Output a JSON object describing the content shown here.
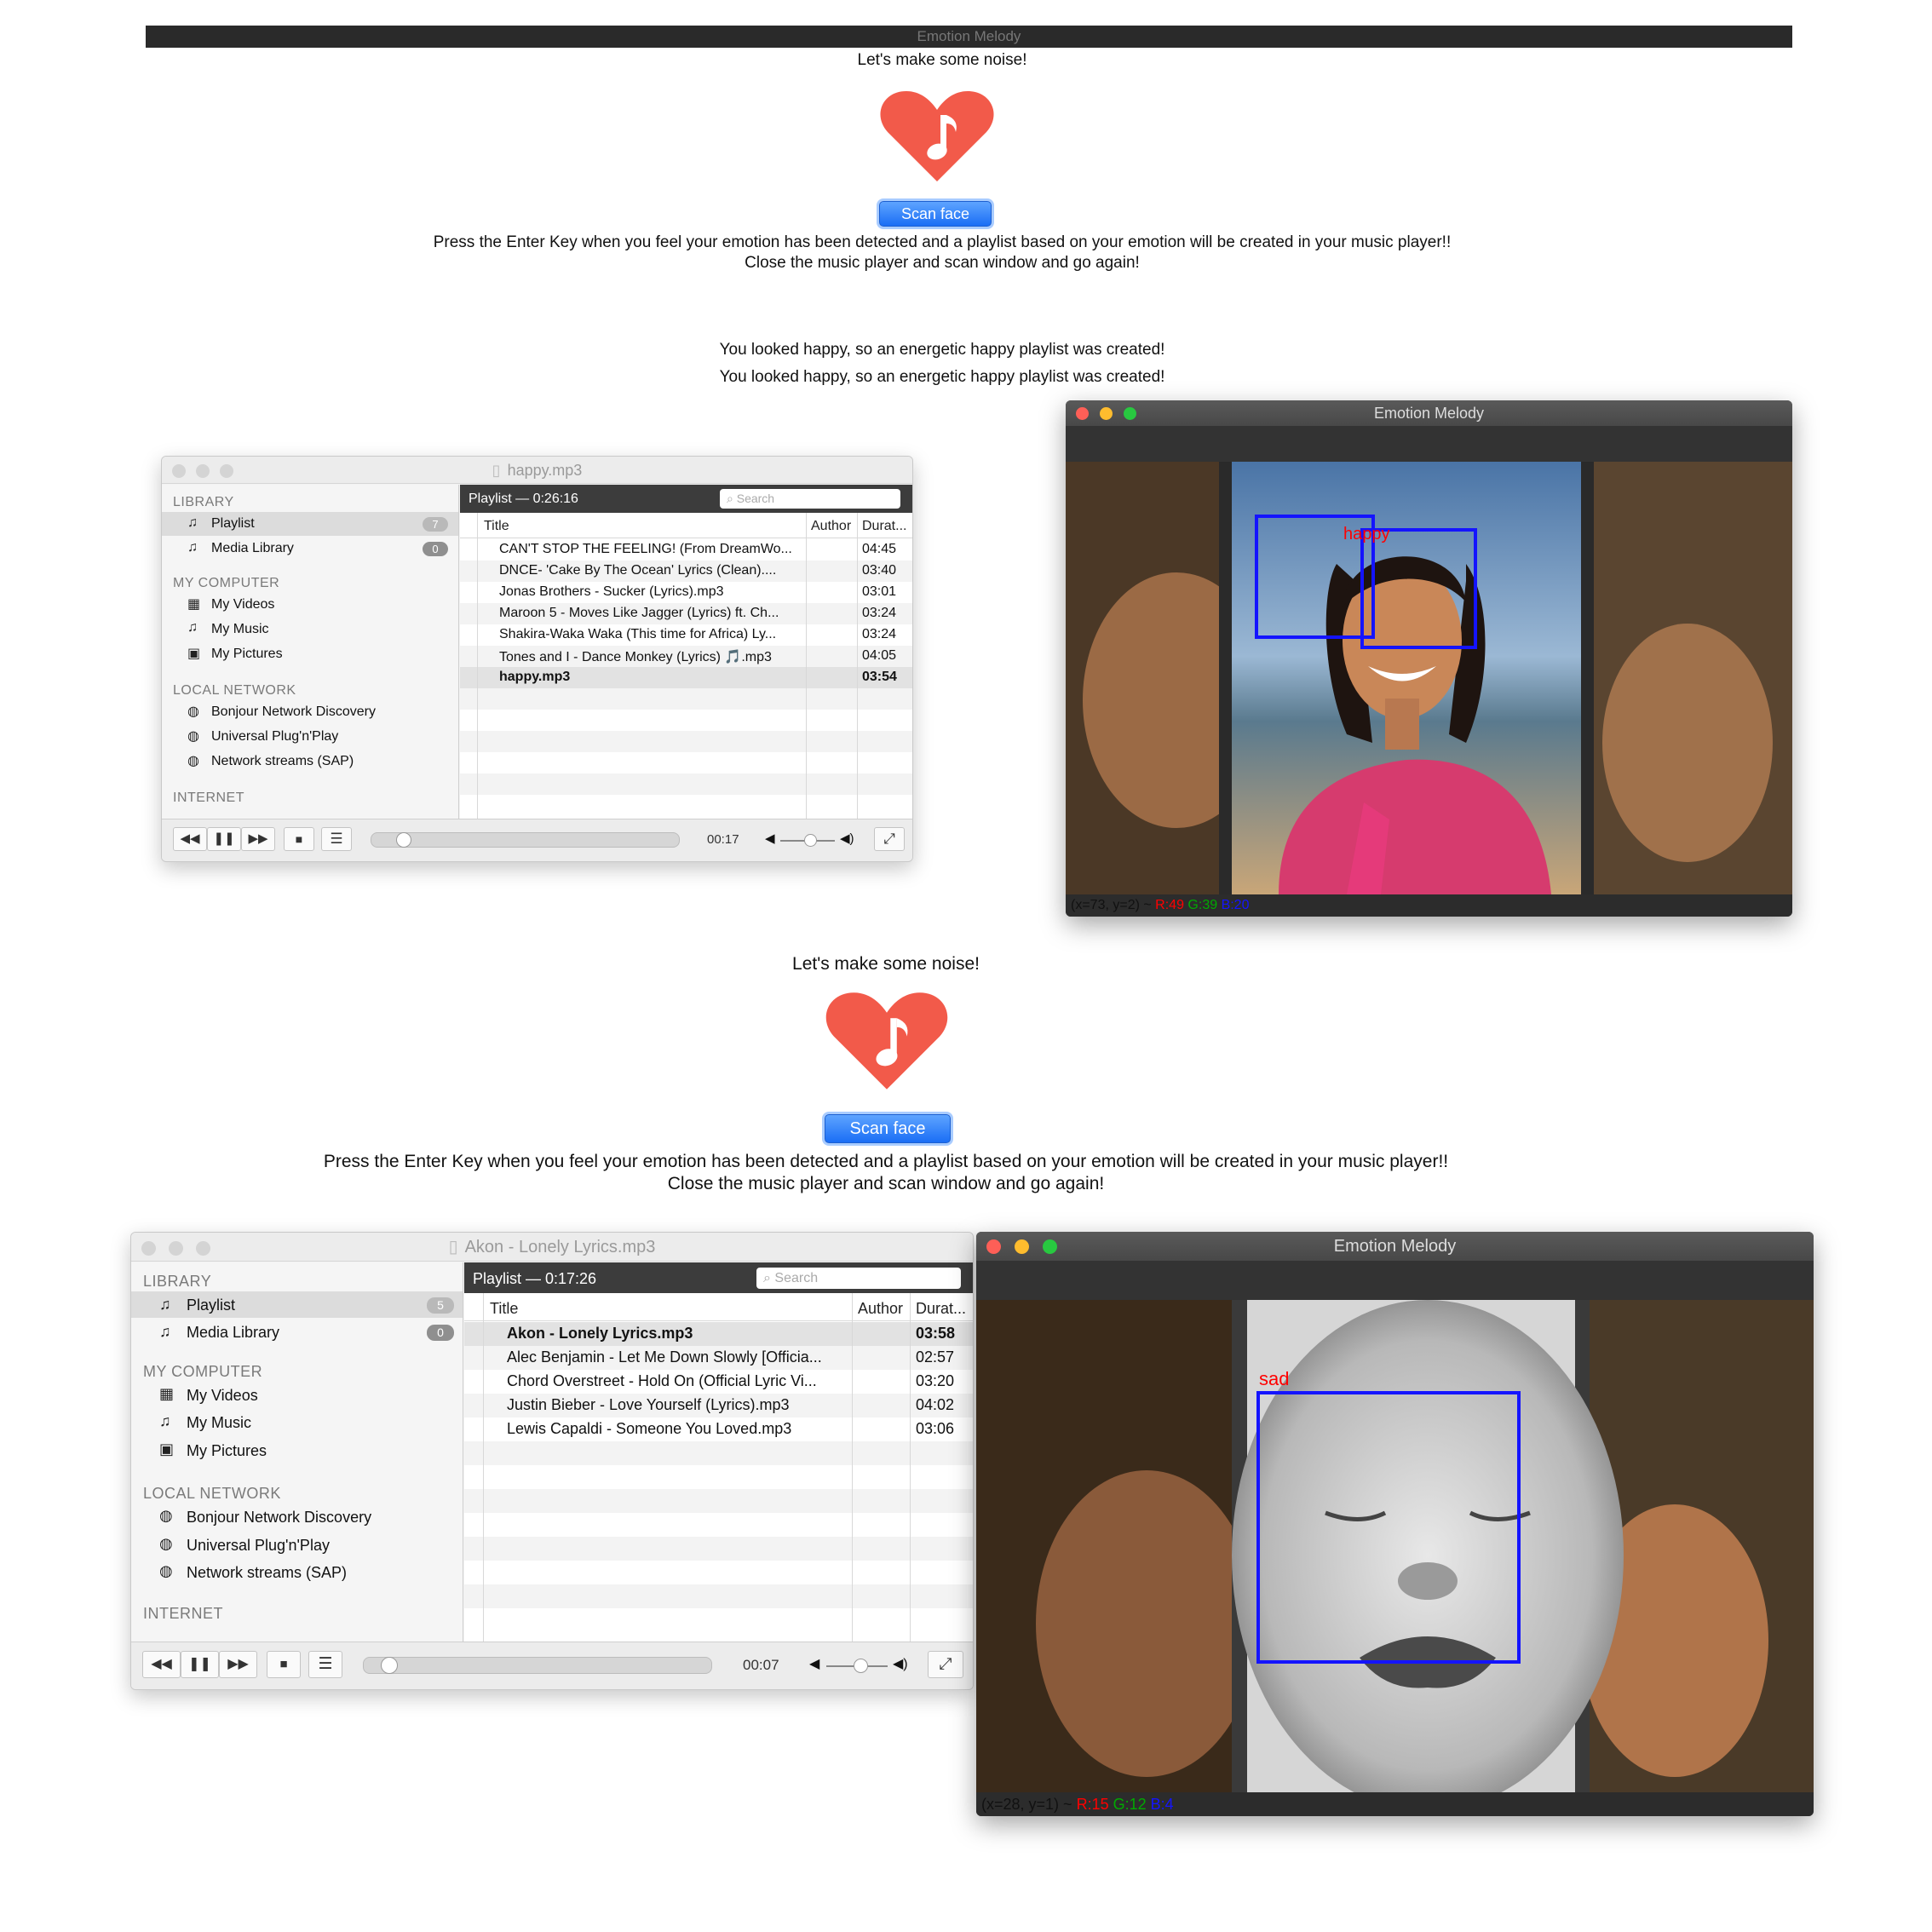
{
  "app_title": "Emotion Melody",
  "intro": {
    "tagline": "Let's make some noise!",
    "scan_button": "Scan face",
    "instruction_line1": "Press the Enter Key when you feel your emotion has been detected and a playlist based on your emotion will be created in your music player!!",
    "instruction_line2": "Close the music player and scan window and go again!"
  },
  "results": {
    "line1": "You looked happy, so an energetic happy playlist was created!",
    "line2": "You looked happy, so an energetic happy playlist was created!"
  },
  "player1": {
    "window_title": "happy.mp3",
    "playlist_header": "Playlist — 0:26:16",
    "search_placeholder": "Search",
    "sidebar": {
      "library_heading": "LIBRARY",
      "playlist_label": "Playlist",
      "playlist_count": "7",
      "media_library_label": "Media Library",
      "media_library_count": "0",
      "computer_heading": "MY COMPUTER",
      "my_videos": "My Videos",
      "my_music": "My Music",
      "my_pictures": "My Pictures",
      "network_heading": "LOCAL NETWORK",
      "bonjour": "Bonjour Network Discovery",
      "upnp": "Universal Plug'n'Play",
      "sap": "Network streams (SAP)",
      "internet_heading": "INTERNET"
    },
    "columns": {
      "title": "Title",
      "author": "Author",
      "duration": "Durat..."
    },
    "tracks": [
      {
        "title": "CAN'T STOP THE FEELING! (From DreamWo...",
        "duration": "04:45"
      },
      {
        "title": "DNCE- 'Cake By The Ocean' Lyrics (Clean)....",
        "duration": "03:40"
      },
      {
        "title": "Jonas Brothers - Sucker (Lyrics).mp3",
        "duration": "03:01"
      },
      {
        "title": "Maroon 5 - Moves Like Jagger (Lyrics) ft. Ch...",
        "duration": "03:24"
      },
      {
        "title": "Shakira-Waka Waka (This time for Africa) Ly...",
        "duration": "03:24"
      },
      {
        "title": "Tones and I - Dance Monkey (Lyrics) 🎵.mp3",
        "duration": "04:05"
      },
      {
        "title": "happy.mp3",
        "duration": "03:54"
      }
    ],
    "elapsed": "00:17",
    "progress": 0.06,
    "volume": 0.55
  },
  "camera1": {
    "title": "Emotion Melody",
    "emotion_label": "happy",
    "status_coords": "(x=73, y=2) ~",
    "status_r": "R:49",
    "status_g": "G:39",
    "status_b": "B:20"
  },
  "intro2": {
    "tagline": "Let's make some noise!",
    "scan_button": "Scan face",
    "instruction_line1": "Press the Enter Key when you feel your emotion has been detected and a playlist based on your emotion will be created in your music player!!",
    "instruction_line2": "Close the music player and scan window and go again!"
  },
  "player2": {
    "window_title": "Akon - Lonely Lyrics.mp3",
    "playlist_header": "Playlist — 0:17:26",
    "search_placeholder": "Search",
    "sidebar": {
      "library_heading": "LIBRARY",
      "playlist_label": "Playlist",
      "playlist_count": "5",
      "media_library_label": "Media Library",
      "media_library_count": "0",
      "computer_heading": "MY COMPUTER",
      "my_videos": "My Videos",
      "my_music": "My Music",
      "my_pictures": "My Pictures",
      "network_heading": "LOCAL NETWORK",
      "bonjour": "Bonjour Network Discovery",
      "upnp": "Universal Plug'n'Play",
      "sap": "Network streams (SAP)",
      "internet_heading": "INTERNET"
    },
    "columns": {
      "title": "Title",
      "author": "Author",
      "duration": "Durat..."
    },
    "tracks": [
      {
        "title": "Akon - Lonely Lyrics.mp3",
        "duration": "03:58"
      },
      {
        "title": "Alec Benjamin - Let Me Down Slowly [Officia...",
        "duration": "02:57"
      },
      {
        "title": "Chord Overstreet - Hold On (Official Lyric Vi...",
        "duration": "03:20"
      },
      {
        "title": "Justin Bieber - Love Yourself (Lyrics).mp3",
        "duration": "04:02"
      },
      {
        "title": "Lewis Capaldi - Someone You Loved.mp3",
        "duration": "03:06"
      }
    ],
    "elapsed": "00:07",
    "progress": 0.03,
    "volume": 0.55
  },
  "camera2": {
    "title": "Emotion Melody",
    "emotion_label": "sad",
    "status_coords": "(x=28, y=1) ~",
    "status_r": "R:15",
    "status_g": "G:12",
    "status_b": "B:4"
  },
  "colors": {
    "heart": "#f25a4a",
    "button": "#1a6ef5",
    "face_box": "#1414ff",
    "emotion_label": "#ff0000"
  }
}
